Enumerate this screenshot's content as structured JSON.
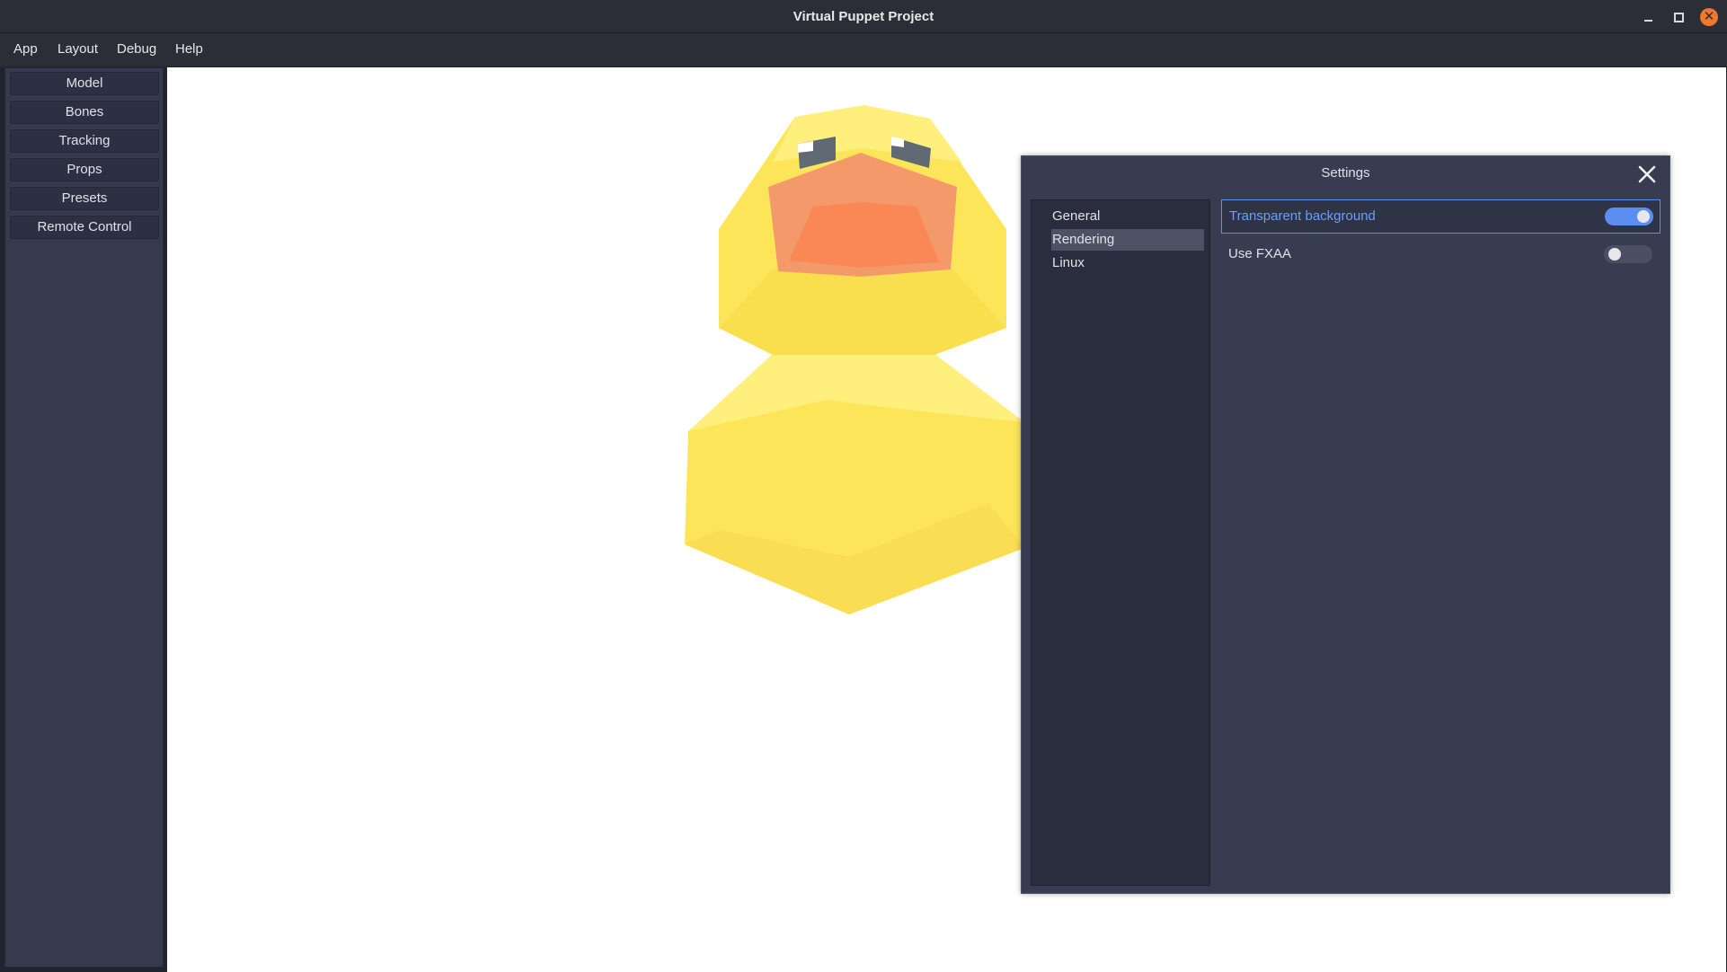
{
  "window": {
    "title": "Virtual Puppet Project"
  },
  "menu": [
    "App",
    "Layout",
    "Debug",
    "Help"
  ],
  "sidebar": {
    "items": [
      "Model",
      "Bones",
      "Tracking",
      "Props",
      "Presets",
      "Remote Control"
    ]
  },
  "settings": {
    "title": "Settings",
    "categories": [
      "General",
      "Rendering",
      "Linux"
    ],
    "selected_category": "Rendering",
    "options": [
      {
        "label": "Transparent background",
        "enabled": true
      },
      {
        "label": "Use FXAA",
        "enabled": false
      }
    ]
  },
  "colors": {
    "accent": "#5b8ef0",
    "toggle_on": "#5b8ef0",
    "toggle_off": "#4a4f62",
    "close_button": "#f0782a"
  }
}
